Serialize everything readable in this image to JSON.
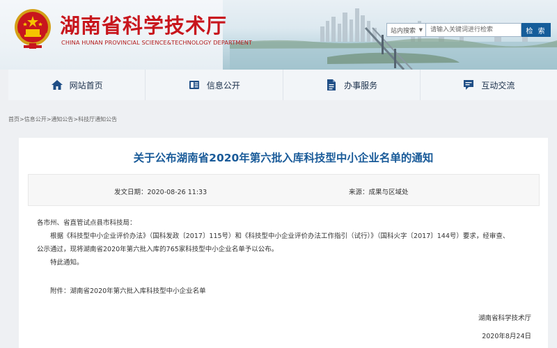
{
  "header": {
    "title": "湖南省科学技术厅",
    "subtitle": "CHINA HUNAN PROVINCIAL SCIENCE&TECHNOLOGY DEPARTMENT"
  },
  "search": {
    "scope": "站内搜索",
    "placeholder": "请输入关键词进行检索",
    "button": "检 索"
  },
  "nav": [
    {
      "label": "网站首页",
      "icon": "home-icon"
    },
    {
      "label": "信息公开",
      "icon": "document-icon"
    },
    {
      "label": "办事服务",
      "icon": "file-service-icon"
    },
    {
      "label": "互动交流",
      "icon": "chat-icon"
    }
  ],
  "breadcrumb": [
    "首页",
    "信息公开",
    "通知公告",
    "科技厅通知公告"
  ],
  "article": {
    "title": "关于公布湖南省2020年第六批入库科技型中小企业名单的通知",
    "date_label": "发文日期：",
    "date": "2020-08-26 11:33",
    "source_label": "来源：",
    "source": "成果与区域处",
    "salutation": "各市州、省直管试点县市科技局：",
    "para1_line1": "根据《科技型中小企业评价办法》（国科发政〔2017〕115号）和《科技型中小企业评价办法工作指引（试行）》（国科火字〔2017〕144号）要求，经审查、",
    "para1_line2": "公示通过，现将湖南省2020年第六批入库的765家科技型中小企业名单予以公布。",
    "closing": "特此通知。",
    "attachment": "附件：湖南省2020年第六批入库科技型中小企业名单",
    "signature_org": "湖南省科学技术厅",
    "signature_date": "2020年8月24日"
  },
  "colors": {
    "title_red": "#c8161d",
    "link_blue": "#1a5b99",
    "search_button": "#155d9a"
  }
}
